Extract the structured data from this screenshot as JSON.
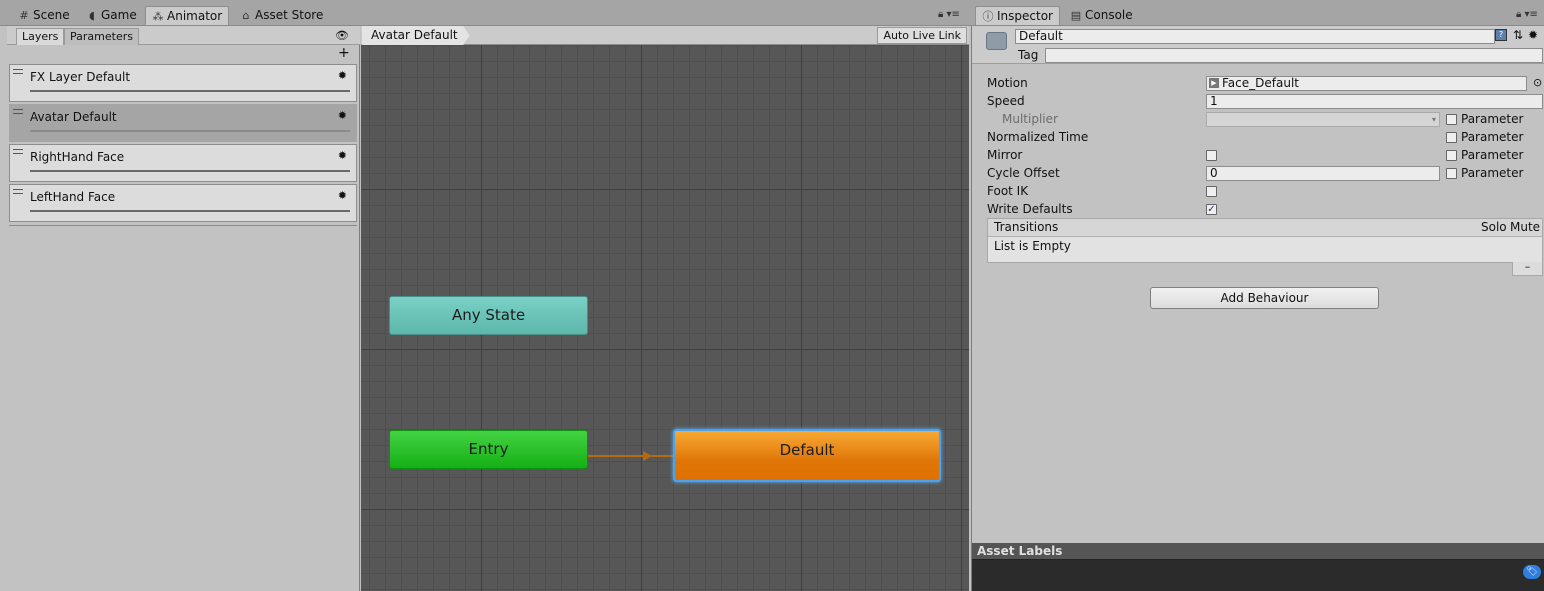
{
  "top_tabs": [
    {
      "icon": "grid-icon",
      "label": "Scene"
    },
    {
      "icon": "gamepad-icon",
      "label": "Game"
    },
    {
      "icon": "animator-icon",
      "label": "Animator"
    },
    {
      "icon": "store-icon",
      "label": "Asset Store"
    }
  ],
  "right_tabs": [
    {
      "icon": "info-icon",
      "label": "Inspector"
    },
    {
      "icon": "console-icon",
      "label": "Console"
    }
  ],
  "layers_panel": {
    "tabs": [
      "Layers",
      "Parameters"
    ],
    "add_label": "+",
    "layers": [
      {
        "name": "FX Layer Default",
        "selected": false
      },
      {
        "name": "Avatar Default",
        "selected": true
      },
      {
        "name": "RightHand Face",
        "selected": false
      },
      {
        "name": "LeftHand Face",
        "selected": false
      }
    ]
  },
  "graph": {
    "breadcrumb": "Avatar Default",
    "auto_live_link": "Auto Live Link",
    "nodes": {
      "any_state": "Any State",
      "entry": "Entry",
      "default": "Default"
    }
  },
  "inspector": {
    "state_name": "Default",
    "tag_label": "Tag",
    "tag_value": "",
    "motion_label": "Motion",
    "motion_value": "Face_Default",
    "speed_label": "Speed",
    "speed_value": "1",
    "multiplier_label": "Multiplier",
    "normalized_time_label": "Normalized Time",
    "mirror_label": "Mirror",
    "cycle_offset_label": "Cycle Offset",
    "cycle_offset_value": "0",
    "foot_ik_label": "Foot IK",
    "write_defaults_label": "Write Defaults",
    "write_defaults_checked": true,
    "parameter_label": "Parameter",
    "transitions_label": "Transitions",
    "solo_label": "Solo",
    "mute_label": "Mute",
    "list_empty": "List is Empty",
    "minus_label": "–",
    "add_behaviour": "Add Behaviour",
    "asset_labels": "Asset Labels"
  },
  "colors": {
    "any_state": "#6cc4b9",
    "entry": "#22bf22",
    "default_state": "#ea8a1c",
    "selection_outline": "#4aa3f0"
  }
}
